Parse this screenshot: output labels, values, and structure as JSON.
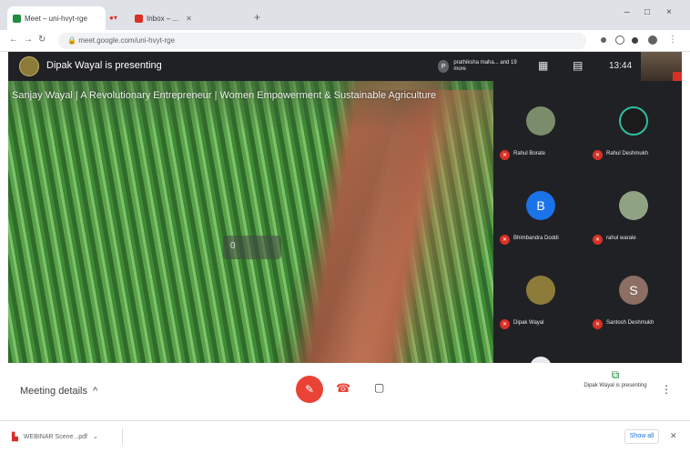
{
  "browser": {
    "tabs": [
      {
        "title": "Meet – uni-hvyt-rge",
        "active": true
      },
      {
        "title": "Inbox – ... ",
        "active": false
      }
    ],
    "new_tab": "+",
    "omnibox_url": "meet.google.com/uni-hvyt-rge",
    "window_controls": [
      "–",
      "□",
      "×"
    ]
  },
  "meet": {
    "presenting_title": "Dipak Wayal is presenting",
    "pinned_chip": "prathiksha maha... and 19 more",
    "pinned_initial": "P",
    "clock": "13:44",
    "slide_title": "Sanjay Wayal | A Revolutionary Entrepreneur | Women Empowerment & Sustainable Agriculture",
    "slide_chip": "0",
    "participants": [
      {
        "name": "Rahul Borate",
        "initial": "",
        "color": "#7b8c6a"
      },
      {
        "name": "Rahul Deshmukh",
        "initial": "",
        "color": "#1b1b1b"
      },
      {
        "name": "Bhimbandra Doddi",
        "initial": "B",
        "color": "#1a73e8"
      },
      {
        "name": "rahul warale",
        "initial": "",
        "color": "#8fa384"
      },
      {
        "name": "Dipak Wayal",
        "initial": "",
        "color": "#8d7b3a"
      },
      {
        "name": "Santosh Deshmukh",
        "initial": "S",
        "color": "#8d6e63"
      }
    ]
  },
  "controls": {
    "meeting_details": "Meeting details",
    "present_status": "Dipak Wayal is presenting"
  },
  "download": {
    "file": "WEBINAR Scene...pdf",
    "show_all": "Show all"
  }
}
